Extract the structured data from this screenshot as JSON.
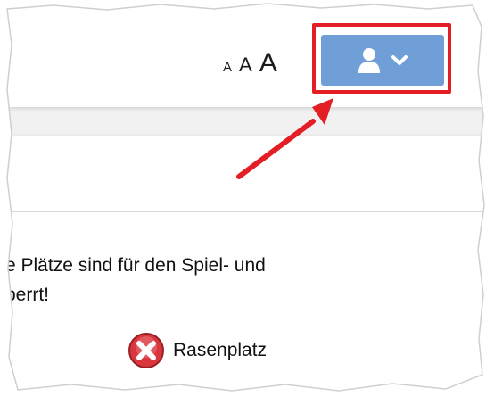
{
  "header": {
    "font_size_controls": [
      {
        "label": "A",
        "size": "small"
      },
      {
        "label": "A",
        "size": "medium"
      },
      {
        "label": "A",
        "size": "large"
      }
    ],
    "user_menu": {
      "icons": [
        "user-icon",
        "chevron-down-icon"
      ],
      "color": "#6f9fd6"
    }
  },
  "annotation": {
    "highlight_color": "#e31e24"
  },
  "notice": {
    "line1": "e Plätze sind für den Spiel- und",
    "line2": "perrt!"
  },
  "facilities": [
    {
      "name": "Rasenplatz",
      "status_icon": "closed-x-icon",
      "status_color": "#d9363e"
    }
  ]
}
